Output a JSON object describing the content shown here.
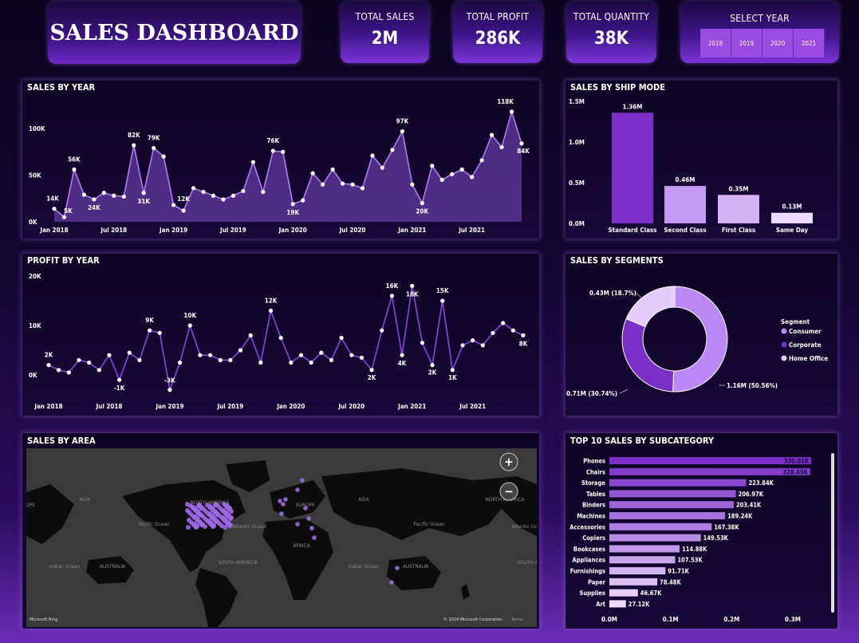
{
  "header": {
    "title": "SALES DASHBOARD"
  },
  "kpis": [
    {
      "label": "TOTAL SALES",
      "value": "2M"
    },
    {
      "label": "TOTAL PROFIT",
      "value": "286K"
    },
    {
      "label": "TOTAL QUANTITY",
      "value": "38K"
    }
  ],
  "year_slicer": {
    "label": "SELECT YEAR",
    "options": [
      "2018",
      "2019",
      "2020",
      "2021"
    ]
  },
  "colors": {
    "accent": "#7b2ec8",
    "line": "#b47bf0",
    "area": "#5a3390",
    "background": "#100530"
  },
  "sales_by_year": {
    "title": "SALES BY YEAR",
    "chart_data": {
      "type": "area",
      "xlabels": [
        "Jan 2018",
        "Jul 2018",
        "Jan 2019",
        "Jul 2019",
        "Jan 2020",
        "Jul 2020",
        "Jan 2021",
        "Jul 2021"
      ],
      "yticks": [
        "0K",
        "50K",
        "100K"
      ],
      "ylim": [
        0,
        130000
      ],
      "values": [
        14000,
        5000,
        56000,
        29000,
        24000,
        31000,
        28000,
        27000,
        82000,
        31000,
        79000,
        70000,
        18000,
        12000,
        36000,
        32000,
        28000,
        24000,
        28000,
        33000,
        64000,
        32000,
        76000,
        75000,
        19000,
        23000,
        52000,
        40000,
        56000,
        41000,
        40000,
        36000,
        71000,
        58000,
        77000,
        97000,
        40000,
        20000,
        60000,
        45000,
        51000,
        56000,
        48000,
        66000,
        93000,
        80000,
        118000,
        84000
      ],
      "data_labels": [
        "14K",
        "5K",
        "56K",
        "24K",
        "82K",
        "31K",
        "79K",
        "12K",
        "76K",
        "19K",
        "97K",
        "20K",
        "118K",
        "84K"
      ]
    }
  },
  "profit_by_year": {
    "title": "PROFIT BY YEAR",
    "chart_data": {
      "type": "line",
      "xlabels": [
        "Jan 2018",
        "Jul 2018",
        "Jan 2019",
        "Jul 2019",
        "Jan 2020",
        "Jul 2020",
        "Jan 2021",
        "Jul 2021"
      ],
      "yticks": [
        "0K",
        "10K",
        "20K"
      ],
      "ylim": [
        -4000,
        20000
      ],
      "values": [
        2000,
        1000,
        500,
        3000,
        2500,
        1000,
        4000,
        -1000,
        4500,
        3000,
        9000,
        8500,
        -3000,
        2500,
        10000,
        4000,
        4000,
        3000,
        3000,
        5000,
        8000,
        2500,
        13000,
        7500,
        2500,
        4000,
        2500,
        4500,
        3000,
        7500,
        4000,
        3500,
        1000,
        9000,
        16000,
        4000,
        18000,
        6500,
        2000,
        15000,
        1000,
        6000,
        7000,
        6000,
        8500,
        10500,
        9000,
        8000
      ],
      "data_labels": [
        "2K",
        "-1K",
        "9K",
        "-3K",
        "10K",
        "12K",
        "2K",
        "16K",
        "4K",
        "18K",
        "2K",
        "15K",
        "1K",
        "8K"
      ]
    }
  },
  "sales_by_ship_mode": {
    "title": "SALES BY SHIP MODE",
    "chart_data": {
      "type": "bar",
      "categories": [
        "Standard Class",
        "Second Class",
        "First Class",
        "Same Day"
      ],
      "values": [
        1.36,
        0.46,
        0.35,
        0.13
      ],
      "data_labels": [
        "1.36M",
        "0.46M",
        "0.35M",
        "0.13M"
      ],
      "yticks": [
        "0.0M",
        "0.5M",
        "1.0M",
        "1.5M"
      ],
      "ylim": [
        0,
        1.5
      ],
      "colors": [
        "#7b2ec8",
        "#c59af2",
        "#d6b5f6",
        "#ecdcfb"
      ]
    }
  },
  "sales_by_segments": {
    "title": "SALES BY SEGMENTS",
    "chart_data": {
      "type": "pie",
      "categories": [
        "Consumer",
        "Corporate",
        "Home Office"
      ],
      "values": [
        50.56,
        30.74,
        18.7
      ],
      "data_labels": [
        "1.16M (50.56%)",
        "0.71M (30.74%)",
        "0.43M (18.7%)"
      ],
      "colors": [
        "#bb86f5",
        "#7a30c7",
        "#e3cbfb"
      ]
    },
    "legend_title": "Segment"
  },
  "sales_by_area": {
    "title": "SALES BY AREA",
    "map_labels": [
      "NORTH AMERICA",
      "EUROPE",
      "ASIA",
      "AFRICA",
      "SOUTH AMERICA",
      "AUSTRALIA",
      "Pacific Ocean",
      "Atlantic Ocean",
      "Indian Ocean",
      "Pacific Ocean",
      "Atlantic Ocean",
      "Indian Ocean",
      "SOUTH AMERICA",
      "ASIA",
      "NORTH AMERICA",
      "AUSTRALIA",
      "OPE"
    ],
    "attribution": "© 2024 Microsoft Corporation",
    "terms": "Terms",
    "bing": "Microsoft Bing",
    "zoom_in": "+",
    "zoom_out": "−"
  },
  "top10_subcategory": {
    "title": "TOP 10 SALES BY SUBCATEGORY",
    "chart_data": {
      "type": "bar",
      "orientation": "horizontal",
      "categories": [
        "Phones",
        "Chairs",
        "Storage",
        "Tables",
        "Binders",
        "Machines",
        "Accessories",
        "Copiers",
        "Bookcases",
        "Appliances",
        "Furnishings",
        "Paper",
        "Supplies",
        "Art"
      ],
      "values": [
        330.01,
        328.45,
        223.84,
        206.97,
        203.41,
        189.24,
        167.38,
        149.53,
        114.88,
        107.53,
        91.71,
        78.48,
        46.67,
        27.12
      ],
      "data_labels": [
        "330.01K",
        "328.45K",
        "223.84K",
        "206.97K",
        "203.41K",
        "189.24K",
        "167.38K",
        "149.53K",
        "114.88K",
        "107.53K",
        "91.71K",
        "78.48K",
        "46.67K",
        "27.12K"
      ],
      "xticks": [
        "0.0M",
        "0.1M",
        "0.2M",
        "0.3M"
      ],
      "xlim": [
        0,
        0.3
      ]
    }
  }
}
